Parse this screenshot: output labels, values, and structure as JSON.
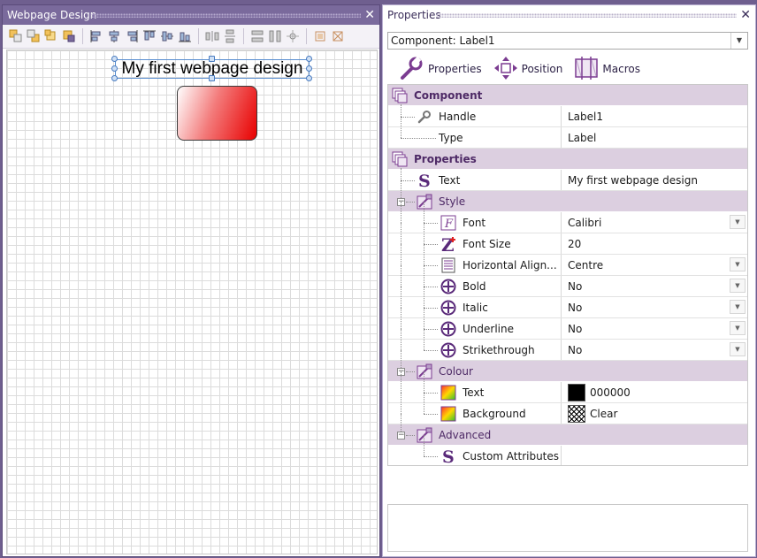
{
  "left_panel": {
    "title": "Webpage Design",
    "close": "✕",
    "toolbar_icons": [
      "bring-forward-icon",
      "send-backward-icon",
      "bring-to-front-icon",
      "send-to-back-icon",
      "align-left-icon",
      "align-center-icon",
      "align-right-icon",
      "align-top-icon",
      "align-middle-icon",
      "align-bottom-icon",
      "space-horizontal-icon",
      "space-vertical-icon",
      "same-width-icon",
      "same-height-icon",
      "center-icon",
      "grid-snap-icon",
      "resize-icon"
    ],
    "canvas": {
      "label_text": "My first webpage design",
      "shape_gradient": [
        "#ffffff",
        "#e80000"
      ]
    }
  },
  "right_panel": {
    "title": "Properties",
    "close": "✕",
    "component_selector": "Component: Label1",
    "tabs": [
      {
        "label": "Properties",
        "icon": "wrench-icon"
      },
      {
        "label": "Position",
        "icon": "move-arrows-icon"
      },
      {
        "label": "Macros",
        "icon": "macro-icon"
      }
    ],
    "sections": {
      "component": {
        "title": "Component",
        "rows": [
          {
            "name": "Handle",
            "value": "Label1",
            "icon": "wrench-icon"
          },
          {
            "name": "Type",
            "value": "Label"
          }
        ]
      },
      "properties": {
        "title": "Properties",
        "text": {
          "name": "Text",
          "value": "My first webpage design"
        },
        "style": {
          "title": "Style",
          "rows": [
            {
              "name": "Font",
              "value": "Calibri",
              "icon": "font-icon"
            },
            {
              "name": "Font Size",
              "value": "20",
              "icon": "font-size-icon"
            },
            {
              "name": "Horizontal Align...",
              "value": "Centre",
              "icon": "document-icon"
            },
            {
              "name": "Bold",
              "value": "No",
              "icon": "plus-circle-icon"
            },
            {
              "name": "Italic",
              "value": "No",
              "icon": "plus-circle-icon"
            },
            {
              "name": "Underline",
              "value": "No",
              "icon": "plus-circle-icon"
            },
            {
              "name": "Strikethrough",
              "value": "No",
              "icon": "plus-circle-icon"
            }
          ]
        },
        "colour": {
          "title": "Colour",
          "rows": [
            {
              "name": "Text",
              "value": "000000",
              "swatch": "#000000"
            },
            {
              "name": "Background",
              "value": "Clear",
              "swatch": "clear"
            }
          ]
        },
        "advanced": {
          "title": "Advanced",
          "rows": [
            {
              "name": "Custom Attributes",
              "value": ""
            }
          ]
        }
      }
    },
    "dropdown_arrow": "▼"
  },
  "colors": {
    "frame": "#6f5f8f",
    "category_bg": "#dccfe0",
    "category_text": "#4e2a66",
    "accent_purple": "#7b3c91"
  }
}
